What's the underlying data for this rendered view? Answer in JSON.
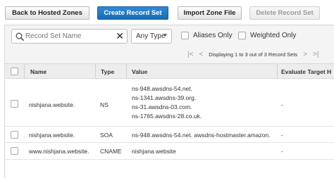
{
  "toolbar": {
    "back_label": "Back to Hosted Zones",
    "create_label": "Create Record Set",
    "import_label": "Import Zone File",
    "delete_label": "Delete Record Set"
  },
  "filters": {
    "search_placeholder": "Record Set Name",
    "clear_glyph": "✕",
    "type_select": "Any Type",
    "aliases_label": "Aliases Only",
    "weighted_label": "Weighted Only"
  },
  "pager": {
    "first": "|<",
    "prev": "<",
    "info": "Displaying 1 to 3 out of 3 Record Sets",
    "next": ">",
    "last": ">|"
  },
  "table": {
    "headers": [
      "Name",
      "Type",
      "Value",
      "Evaluate Target H"
    ],
    "rows": [
      {
        "name": "nishjana.website.",
        "type": "NS",
        "values": [
          "ns-948.awsdns-54.net.",
          "ns-1341.awsdns-39.org.",
          "ns-31.awsdns-03.com.",
          "ns-1765.awsdns-28.co.uk."
        ],
        "evaluate": "-"
      },
      {
        "name": "nishjana.website.",
        "type": "SOA",
        "values": [
          "ns-948.awsdns-54.net. awsdns-hostmaster.amazon."
        ],
        "evaluate": "-"
      },
      {
        "name": "www.nishjana.website.",
        "type": "CNAME",
        "values": [
          "nishjana.website"
        ],
        "evaluate": "-"
      }
    ]
  }
}
